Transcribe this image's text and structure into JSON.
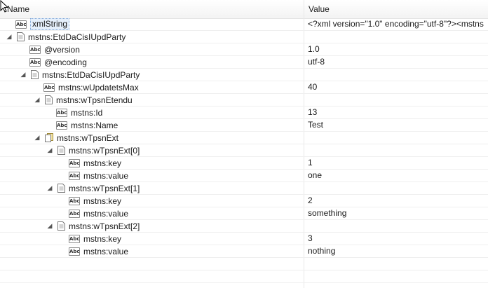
{
  "header": {
    "name_label": "Name",
    "value_label": "Value"
  },
  "rows": [
    {
      "label": "xmlString",
      "value": "<?xml version=\"1.0\" encoding=\"utf-8\"?><mstns"
    },
    {
      "label": "mstns:EtdDaCisIUpdParty",
      "value": ""
    },
    {
      "label": "@version",
      "value": "1.0"
    },
    {
      "label": "@encoding",
      "value": "utf-8"
    },
    {
      "label": "mstns:EtdDaCisIUpdParty",
      "value": ""
    },
    {
      "label": "mstns:wUpdatetsMax",
      "value": "40"
    },
    {
      "label": "mstns:wTpsnEtendu",
      "value": ""
    },
    {
      "label": "mstns:Id",
      "value": "13"
    },
    {
      "label": "mstns:Name",
      "value": "Test"
    },
    {
      "label": "mstns:wTpsnExt",
      "value": ""
    },
    {
      "label": "mstns:wTpsnExt[0]",
      "value": ""
    },
    {
      "label": "mstns:key",
      "value": "1"
    },
    {
      "label": "mstns:value",
      "value": "one"
    },
    {
      "label": "mstns:wTpsnExt[1]",
      "value": ""
    },
    {
      "label": "mstns:key",
      "value": "2"
    },
    {
      "label": "mstns:value",
      "value": "something"
    },
    {
      "label": "mstns:wTpsnExt[2]",
      "value": ""
    },
    {
      "label": "mstns:key",
      "value": "3"
    },
    {
      "label": "mstns:value",
      "value": "nothing"
    }
  ]
}
